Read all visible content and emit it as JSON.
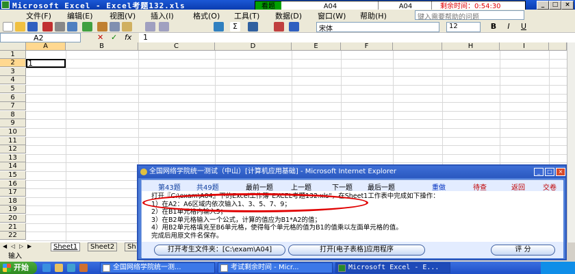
{
  "window": {
    "title": "Microsoft Excel - Excel考题132.xls",
    "min": "_",
    "max": "□",
    "close": "×"
  },
  "exam_bar": {
    "look": "看题",
    "cell1": "A04",
    "cell2": "A04",
    "remaining": "剩余时间：0:54:30"
  },
  "menu": [
    "文件(F)",
    "编辑(E)",
    "视图(V)",
    "插入(I)",
    "格式(O)",
    "工具(T)",
    "数据(D)",
    "窗口(W)",
    "帮助(H)"
  ],
  "help_box": "键入需要帮助的问题",
  "toolbar": {
    "font_name": "宋体",
    "font_size": "12",
    "bold": "B",
    "italic": "I",
    "underline": "U"
  },
  "formula_bar": {
    "name_box": "A2",
    "cancel": "✕",
    "enter": "✓",
    "fx": "fx",
    "value": "1"
  },
  "grid": {
    "columns": [
      "A",
      "B",
      "C",
      "D",
      "E",
      "F",
      "H",
      "I"
    ],
    "rows": [
      "1",
      "2",
      "3",
      "4",
      "5",
      "6",
      "7",
      "8",
      "9",
      "10",
      "11",
      "12",
      "13",
      "14",
      "15",
      "16",
      "17",
      "18",
      "19",
      "20",
      "21",
      "22"
    ],
    "active_value": "1"
  },
  "sheets": {
    "tabs": [
      "Sheet1",
      "Sheet2",
      "Sh"
    ],
    "status": "输入"
  },
  "dialog": {
    "title": "全国网络学院统一测试（中山）[计算机应用基础] - Microsoft Internet Explorer",
    "q_num": "第43题",
    "q_total": "共49题",
    "nav": [
      "最前一题",
      "上一题",
      "下一题",
      "最后一题"
    ],
    "redo": "重做",
    "check": "待查",
    "back": "返回",
    "submit": "交卷",
    "lines": [
      "打开『C:\\exam\\A04』下的Excel工作簿\"EXCEL考题132.xls\"，在Sheet1工作表中完成如下操作：",
      "1）在A2：A6区域内依次输入1、3、5、7、9；",
      "2）在B1单元格内输入5；",
      "3）在B2单元格输入一个公式，计算的值应为B1*A2的值；",
      "4）用B2单元格填充至B6单元格，使得每个单元格的值为B1的值乘以左面单元格的值。",
      "完成后用原文件名保存。"
    ],
    "open_folder": "打开考生文件夹：[C:\\exam\\A04]",
    "open_app": "打开[电子表格]应用程序",
    "score": "评 分"
  },
  "taskbar": {
    "start": "开始",
    "buttons": [
      "全国网络学院统一测...",
      "考试剩余时间 - Micr...",
      "Microsoft Excel - E..."
    ]
  },
  "colors": {
    "title_blue": "#0a3cb0",
    "exam_green": "#00a000",
    "red": "#e00000",
    "dialog_blue": "#4f7fd9"
  }
}
